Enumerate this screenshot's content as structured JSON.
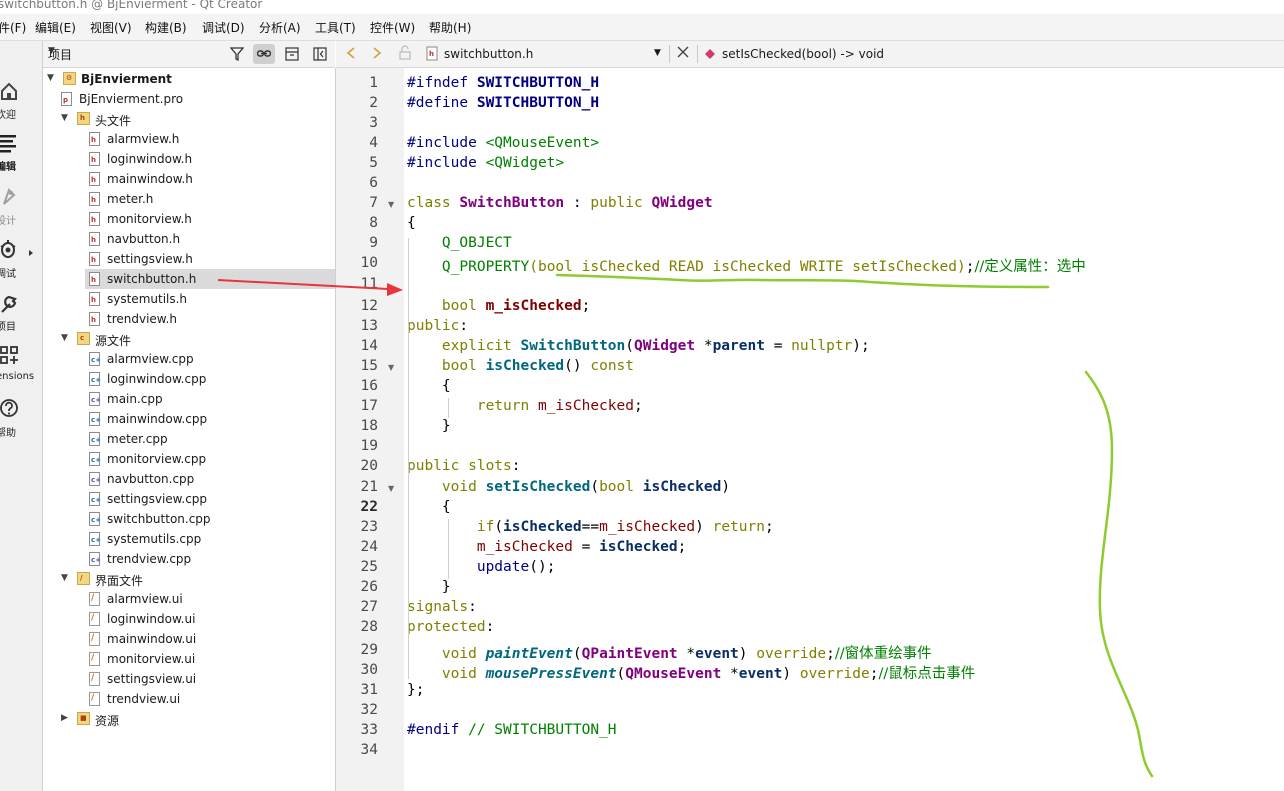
{
  "window": {
    "title": "switchbutton.h @ BjEnvierment - Qt Creator"
  },
  "menu": [
    "件(F)",
    "编辑(E)",
    "视图(V)",
    "构建(B)",
    "调试(D)",
    "分析(A)",
    "工具(T)",
    "控件(W)",
    "帮助(H)"
  ],
  "modes": [
    {
      "label": "欢迎",
      "icon": "home-icon"
    },
    {
      "label": "编辑",
      "icon": "edit-icon"
    },
    {
      "label": "设计",
      "icon": "design-icon"
    },
    {
      "label": "调试",
      "icon": "debug-icon"
    },
    {
      "label": "项目",
      "icon": "wrench-icon"
    },
    {
      "label": "ensions",
      "icon": "extensions-icon"
    },
    {
      "label": "帮助",
      "icon": "help-icon"
    }
  ],
  "project_panel": {
    "view_selector": "项目",
    "tree": [
      {
        "label": "BjEnvierment",
        "kind": "project",
        "depth": 0,
        "expanded": true
      },
      {
        "label": "BjEnvierment.pro",
        "kind": "pro",
        "depth": 1
      },
      {
        "label": "头文件",
        "kind": "folder",
        "depth": 1,
        "expanded": true
      },
      {
        "label": "alarmview.h",
        "kind": "h",
        "depth": 2
      },
      {
        "label": "loginwindow.h",
        "kind": "h",
        "depth": 2
      },
      {
        "label": "mainwindow.h",
        "kind": "h",
        "depth": 2
      },
      {
        "label": "meter.h",
        "kind": "h",
        "depth": 2
      },
      {
        "label": "monitorview.h",
        "kind": "h",
        "depth": 2
      },
      {
        "label": "navbutton.h",
        "kind": "h",
        "depth": 2
      },
      {
        "label": "settingsview.h",
        "kind": "h",
        "depth": 2
      },
      {
        "label": "switchbutton.h",
        "kind": "h",
        "depth": 2,
        "selected": true
      },
      {
        "label": "systemutils.h",
        "kind": "h",
        "depth": 2
      },
      {
        "label": "trendview.h",
        "kind": "h",
        "depth": 2
      },
      {
        "label": "源文件",
        "kind": "folder",
        "depth": 1,
        "expanded": true
      },
      {
        "label": "alarmview.cpp",
        "kind": "cpp",
        "depth": 2
      },
      {
        "label": "loginwindow.cpp",
        "kind": "cpp",
        "depth": 2
      },
      {
        "label": "main.cpp",
        "kind": "cpp",
        "depth": 2
      },
      {
        "label": "mainwindow.cpp",
        "kind": "cpp",
        "depth": 2
      },
      {
        "label": "meter.cpp",
        "kind": "cpp",
        "depth": 2
      },
      {
        "label": "monitorview.cpp",
        "kind": "cpp",
        "depth": 2
      },
      {
        "label": "navbutton.cpp",
        "kind": "cpp",
        "depth": 2
      },
      {
        "label": "settingsview.cpp",
        "kind": "cpp",
        "depth": 2
      },
      {
        "label": "switchbutton.cpp",
        "kind": "cpp",
        "depth": 2
      },
      {
        "label": "systemutils.cpp",
        "kind": "cpp",
        "depth": 2
      },
      {
        "label": "trendview.cpp",
        "kind": "cpp",
        "depth": 2
      },
      {
        "label": "界面文件",
        "kind": "uifolder",
        "depth": 1,
        "expanded": true
      },
      {
        "label": "alarmview.ui",
        "kind": "ui",
        "depth": 2
      },
      {
        "label": "loginwindow.ui",
        "kind": "ui",
        "depth": 2
      },
      {
        "label": "mainwindow.ui",
        "kind": "ui",
        "depth": 2
      },
      {
        "label": "monitorview.ui",
        "kind": "ui",
        "depth": 2
      },
      {
        "label": "settingsview.ui",
        "kind": "ui",
        "depth": 2
      },
      {
        "label": "trendview.ui",
        "kind": "ui",
        "depth": 2
      },
      {
        "label": "资源",
        "kind": "resfolder",
        "depth": 1,
        "expanded": false
      }
    ]
  },
  "editor": {
    "file_name": "switchbutton.h",
    "symbol": "setIsChecked(bool) -> void",
    "current_line": 22,
    "lines": [
      [
        [
          "#ifndef ",
          "pp"
        ],
        [
          "SWITCHBUTTON_H",
          "mac"
        ]
      ],
      [
        [
          "#define ",
          "pp"
        ],
        [
          "SWITCHBUTTON_H",
          "mac"
        ]
      ],
      [],
      [
        [
          "#include ",
          "pp"
        ],
        [
          "<QMouseEvent>",
          "hd"
        ]
      ],
      [
        [
          "#include ",
          "pp"
        ],
        [
          "<QWidget>",
          "hd"
        ]
      ],
      [],
      [
        [
          "class ",
          "kw"
        ],
        [
          "SwitchButton",
          "ty"
        ],
        [
          " : ",
          "pl"
        ],
        [
          "public ",
          "kw"
        ],
        [
          "QWidget",
          "ty"
        ]
      ],
      [
        [
          "{",
          "pl"
        ]
      ],
      [
        [
          "    ",
          "pl"
        ],
        [
          "Q_OBJECT",
          "hd"
        ]
      ],
      [
        [
          "    ",
          "pl"
        ],
        [
          "Q_PROPERTY",
          "hd"
        ],
        [
          "(bool isChecked READ isChecked WRITE setIsChecked)",
          "kw"
        ],
        [
          ";",
          "pl"
        ],
        [
          "//定义属性：选中",
          "cmt"
        ]
      ],
      [],
      [
        [
          "    ",
          "pl"
        ],
        [
          "bool ",
          "kw"
        ],
        [
          "m_isChecked",
          "mbb"
        ],
        [
          ";",
          "pl"
        ]
      ],
      [
        [
          "public",
          "kw"
        ],
        [
          ":",
          "pl"
        ]
      ],
      [
        [
          "    ",
          "pl"
        ],
        [
          "explicit ",
          "kw"
        ],
        [
          "SwitchButton",
          "fn"
        ],
        [
          "(",
          "pl"
        ],
        [
          "QWidget",
          "ty"
        ],
        [
          " *",
          "pl"
        ],
        [
          "parent",
          "prm"
        ],
        [
          " = ",
          "pl"
        ],
        [
          "nullptr",
          "kw"
        ],
        [
          ");",
          "pl"
        ]
      ],
      [
        [
          "    ",
          "pl"
        ],
        [
          "bool ",
          "kw"
        ],
        [
          "isChecked",
          "fn"
        ],
        [
          "() ",
          "pl"
        ],
        [
          "const",
          "kw"
        ]
      ],
      [
        [
          "    {",
          "pl"
        ]
      ],
      [
        [
          "        ",
          "pl"
        ],
        [
          "return ",
          "kw"
        ],
        [
          "m_isChecked",
          "mb"
        ],
        [
          ";",
          "pl"
        ]
      ],
      [
        [
          "    }",
          "pl"
        ]
      ],
      [],
      [
        [
          "public slots",
          "kw"
        ],
        [
          ":",
          "pl"
        ]
      ],
      [
        [
          "    ",
          "pl"
        ],
        [
          "void ",
          "kw"
        ],
        [
          "setIsChecked",
          "fn"
        ],
        [
          "(",
          "pl"
        ],
        [
          "bool ",
          "kw"
        ],
        [
          "isChecked",
          "prm"
        ],
        [
          ")",
          "pl"
        ]
      ],
      [
        [
          "    {",
          "pl"
        ]
      ],
      [
        [
          "        ",
          "pl"
        ],
        [
          "if",
          "kw"
        ],
        [
          "(",
          "pl"
        ],
        [
          "isChecked",
          "prm"
        ],
        [
          "==",
          "pl"
        ],
        [
          "m_isChecked",
          "mb"
        ],
        [
          ") ",
          "pl"
        ],
        [
          "return",
          "kw"
        ],
        [
          ";",
          "pl"
        ]
      ],
      [
        [
          "        ",
          "pl"
        ],
        [
          "m_isChecked",
          "mb"
        ],
        [
          " = ",
          "pl"
        ],
        [
          "isChecked",
          "prm"
        ],
        [
          ";",
          "pl"
        ]
      ],
      [
        [
          "        ",
          "pl"
        ],
        [
          "update",
          "qt"
        ],
        [
          "();",
          "pl"
        ]
      ],
      [
        [
          "    }",
          "pl"
        ]
      ],
      [
        [
          "signals",
          "kw"
        ],
        [
          ":",
          "pl"
        ]
      ],
      [
        [
          "protected",
          "kw"
        ],
        [
          ":",
          "pl"
        ]
      ],
      [
        [
          "    ",
          "pl"
        ],
        [
          "void ",
          "kw"
        ],
        [
          "paintEvent",
          "fi"
        ],
        [
          "(",
          "pl"
        ],
        [
          "QPaintEvent",
          "ty"
        ],
        [
          " *",
          "pl"
        ],
        [
          "event",
          "prm"
        ],
        [
          ") ",
          "pl"
        ],
        [
          "override",
          "kw"
        ],
        [
          ";",
          "pl"
        ],
        [
          "//窗体重绘事件",
          "cmt"
        ]
      ],
      [
        [
          "    ",
          "pl"
        ],
        [
          "void ",
          "kw"
        ],
        [
          "mousePressEvent",
          "fi"
        ],
        [
          "(",
          "pl"
        ],
        [
          "QMouseEvent",
          "ty"
        ],
        [
          " *",
          "pl"
        ],
        [
          "event",
          "prm"
        ],
        [
          ") ",
          "pl"
        ],
        [
          "override",
          "kw"
        ],
        [
          ";",
          "pl"
        ],
        [
          "//鼠标点击事件",
          "cmt"
        ]
      ],
      [
        [
          "};",
          "pl"
        ]
      ],
      [],
      [
        [
          "#endif ",
          "pp"
        ],
        [
          "// SWITCHBUTTON_H",
          "hd"
        ]
      ],
      []
    ],
    "fold_markers": [
      7,
      15,
      21
    ]
  },
  "annotations": {
    "arrow_color": "#e8343a",
    "underline_color": "#8ccc2e",
    "squiggle_color": "#8ccc2e"
  }
}
